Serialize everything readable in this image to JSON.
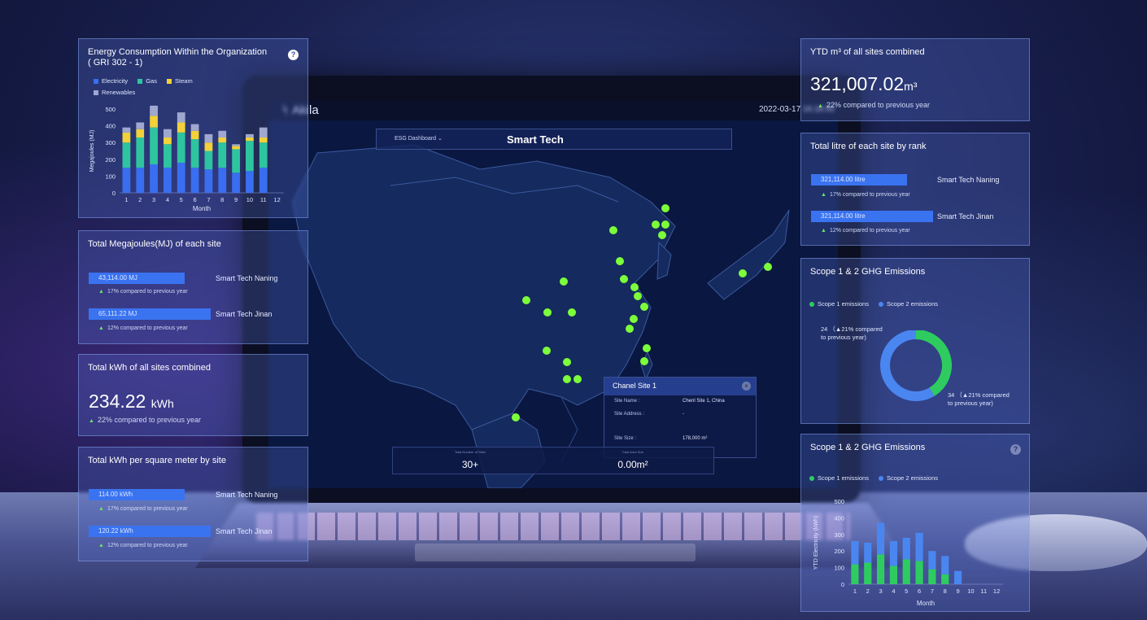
{
  "colors": {
    "electricity": "#3a6ef0",
    "gas": "#2ec4a0",
    "steam": "#f2d13a",
    "renewables": "#a0a8d0",
    "scope1": "#2ecc60",
    "scope2": "#4a86f0",
    "site_dot": "#7cff3a"
  },
  "app": {
    "brand": "Akila",
    "date": "2022-03-17 16:18:50",
    "dashboard_select": "ESG Dashboard",
    "title": "Smart Tech"
  },
  "popup": {
    "title": "Chanel Site 1",
    "close": "×",
    "rows": [
      {
        "label": "Site Name :",
        "value": "Chenl Site 1, China"
      },
      {
        "label": "Site Address :",
        "value": "-"
      },
      {
        "label": "Site Size :",
        "value": "178,000 m²"
      }
    ]
  },
  "stats": [
    {
      "label": "Total Number of Sites",
      "value": "30+"
    },
    {
      "label": "Total Area Size",
      "value": "0.00m²"
    }
  ],
  "energy_panel": {
    "title_line1": "Energy Consumption Within the Organization",
    "title_line2": "( GRI 302 - 1)",
    "help": "?",
    "legend": [
      "Electricity",
      "Gas",
      "Steam",
      "Renewables"
    ],
    "ylabel": "Megajoules (MJ)",
    "xlabel": "Month"
  },
  "chart_data": [
    {
      "type": "bar",
      "stacked": true,
      "title": "Energy Consumption Within the Organization ( GRI 302 - 1)",
      "xlabel": "Month",
      "ylabel": "Megajoules (MJ)",
      "ylim": [
        0,
        500
      ],
      "yticks": [
        0,
        100,
        200,
        300,
        400,
        500
      ],
      "categories": [
        "1",
        "2",
        "3",
        "4",
        "5",
        "6",
        "7",
        "8",
        "9",
        "10",
        "11",
        "12"
      ],
      "series": [
        {
          "name": "Electricity",
          "values": [
            150,
            150,
            170,
            150,
            180,
            150,
            140,
            150,
            120,
            130,
            150,
            0
          ]
        },
        {
          "name": "Gas",
          "values": [
            150,
            180,
            220,
            140,
            180,
            170,
            110,
            150,
            140,
            180,
            150,
            0
          ]
        },
        {
          "name": "Steam",
          "values": [
            60,
            50,
            70,
            40,
            60,
            50,
            50,
            30,
            20,
            20,
            30,
            0
          ]
        },
        {
          "name": "Renewables",
          "values": [
            30,
            40,
            60,
            50,
            60,
            40,
            50,
            40,
            10,
            20,
            60,
            0
          ]
        }
      ],
      "legend": "top-left",
      "grid": false
    },
    {
      "type": "pie",
      "title": "Scope 1 & 2 GHG Emissions",
      "series": [
        {
          "name": "Scope 1 emissions",
          "values": [
            24
          ]
        },
        {
          "name": "Scope 2 emissions",
          "values": [
            34
          ]
        }
      ],
      "donut": true,
      "legend": "top-left"
    },
    {
      "type": "bar",
      "stacked": true,
      "title": "Scope 1 & 2 GHG Emissions",
      "xlabel": "Month",
      "ylabel": "YTD Electricity (kWh)",
      "ylim": [
        0,
        500
      ],
      "yticks": [
        0,
        100,
        200,
        300,
        400,
        500
      ],
      "categories": [
        "1",
        "2",
        "3",
        "4",
        "5",
        "6",
        "7",
        "8",
        "9",
        "10",
        "11",
        "12"
      ],
      "series": [
        {
          "name": "Scope 1 emissions",
          "values": [
            120,
            130,
            180,
            110,
            150,
            140,
            90,
            60,
            0,
            0,
            0,
            0
          ]
        },
        {
          "name": "Scope 2 emissions",
          "values": [
            140,
            120,
            190,
            150,
            130,
            170,
            110,
            110,
            80,
            0,
            0,
            0
          ]
        }
      ],
      "legend": "top-left",
      "grid": false
    }
  ],
  "mj_panel": {
    "title": "Total Megajoules(MJ) of each site",
    "items": [
      {
        "value": "43,114.00 MJ",
        "site": "Smart Tech Naning",
        "delta": "17% compared to previous year"
      },
      {
        "value": "65,111.22 MJ",
        "site": "Smart Tech Jinan",
        "delta": "12% compared to previous year"
      }
    ]
  },
  "kwh_total_panel": {
    "title": "Total kWh of all sites combined",
    "value": "234.22",
    "unit": "kWh",
    "delta": "22% compared to previous year"
  },
  "kwh_sqm_panel": {
    "title": "Total kWh per square meter by site",
    "items": [
      {
        "value": "114.00 kWh",
        "site": "Smart Tech  Naning",
        "delta": "17% compared to previous year"
      },
      {
        "value": "120.22 kWh",
        "site": "Smart Tech Jinan",
        "delta": "12% compared to previous year"
      }
    ]
  },
  "ytd_panel": {
    "title": "YTD m³ of all sites combined",
    "value": "321,007.02",
    "unit": "m³",
    "delta": "22% compared to previous year"
  },
  "litre_panel": {
    "title": "Total litre of each site by rank",
    "items": [
      {
        "value": "321,114.00 litre",
        "site": "Smart Tech Naning",
        "delta": "17% compared to previous year"
      },
      {
        "value": "321,114.00 litre",
        "site": "Smart Tech Jinan",
        "delta": "12% compared to previous year"
      }
    ]
  },
  "ghg_donut_panel": {
    "title": "Scope 1 & 2 GHG Emissions",
    "legend": [
      "Scope 1 emissions",
      "Scope 2 emissions"
    ],
    "note1_line1": "24 （▲21% compared",
    "note1_line2": "to previous year)",
    "note2_line1": "34 （▲21% compared",
    "note2_line2": "to previous year)"
  },
  "ghg_bar_panel": {
    "title": "Scope 1 & 2 GHG Emissions",
    "help": "?",
    "legend": [
      "Scope 1 emissions",
      "Scope 2 emissions"
    ],
    "ylabel": "YTD Electricity (kWh)",
    "xlabel": "Month"
  },
  "up_glyph": "▲"
}
